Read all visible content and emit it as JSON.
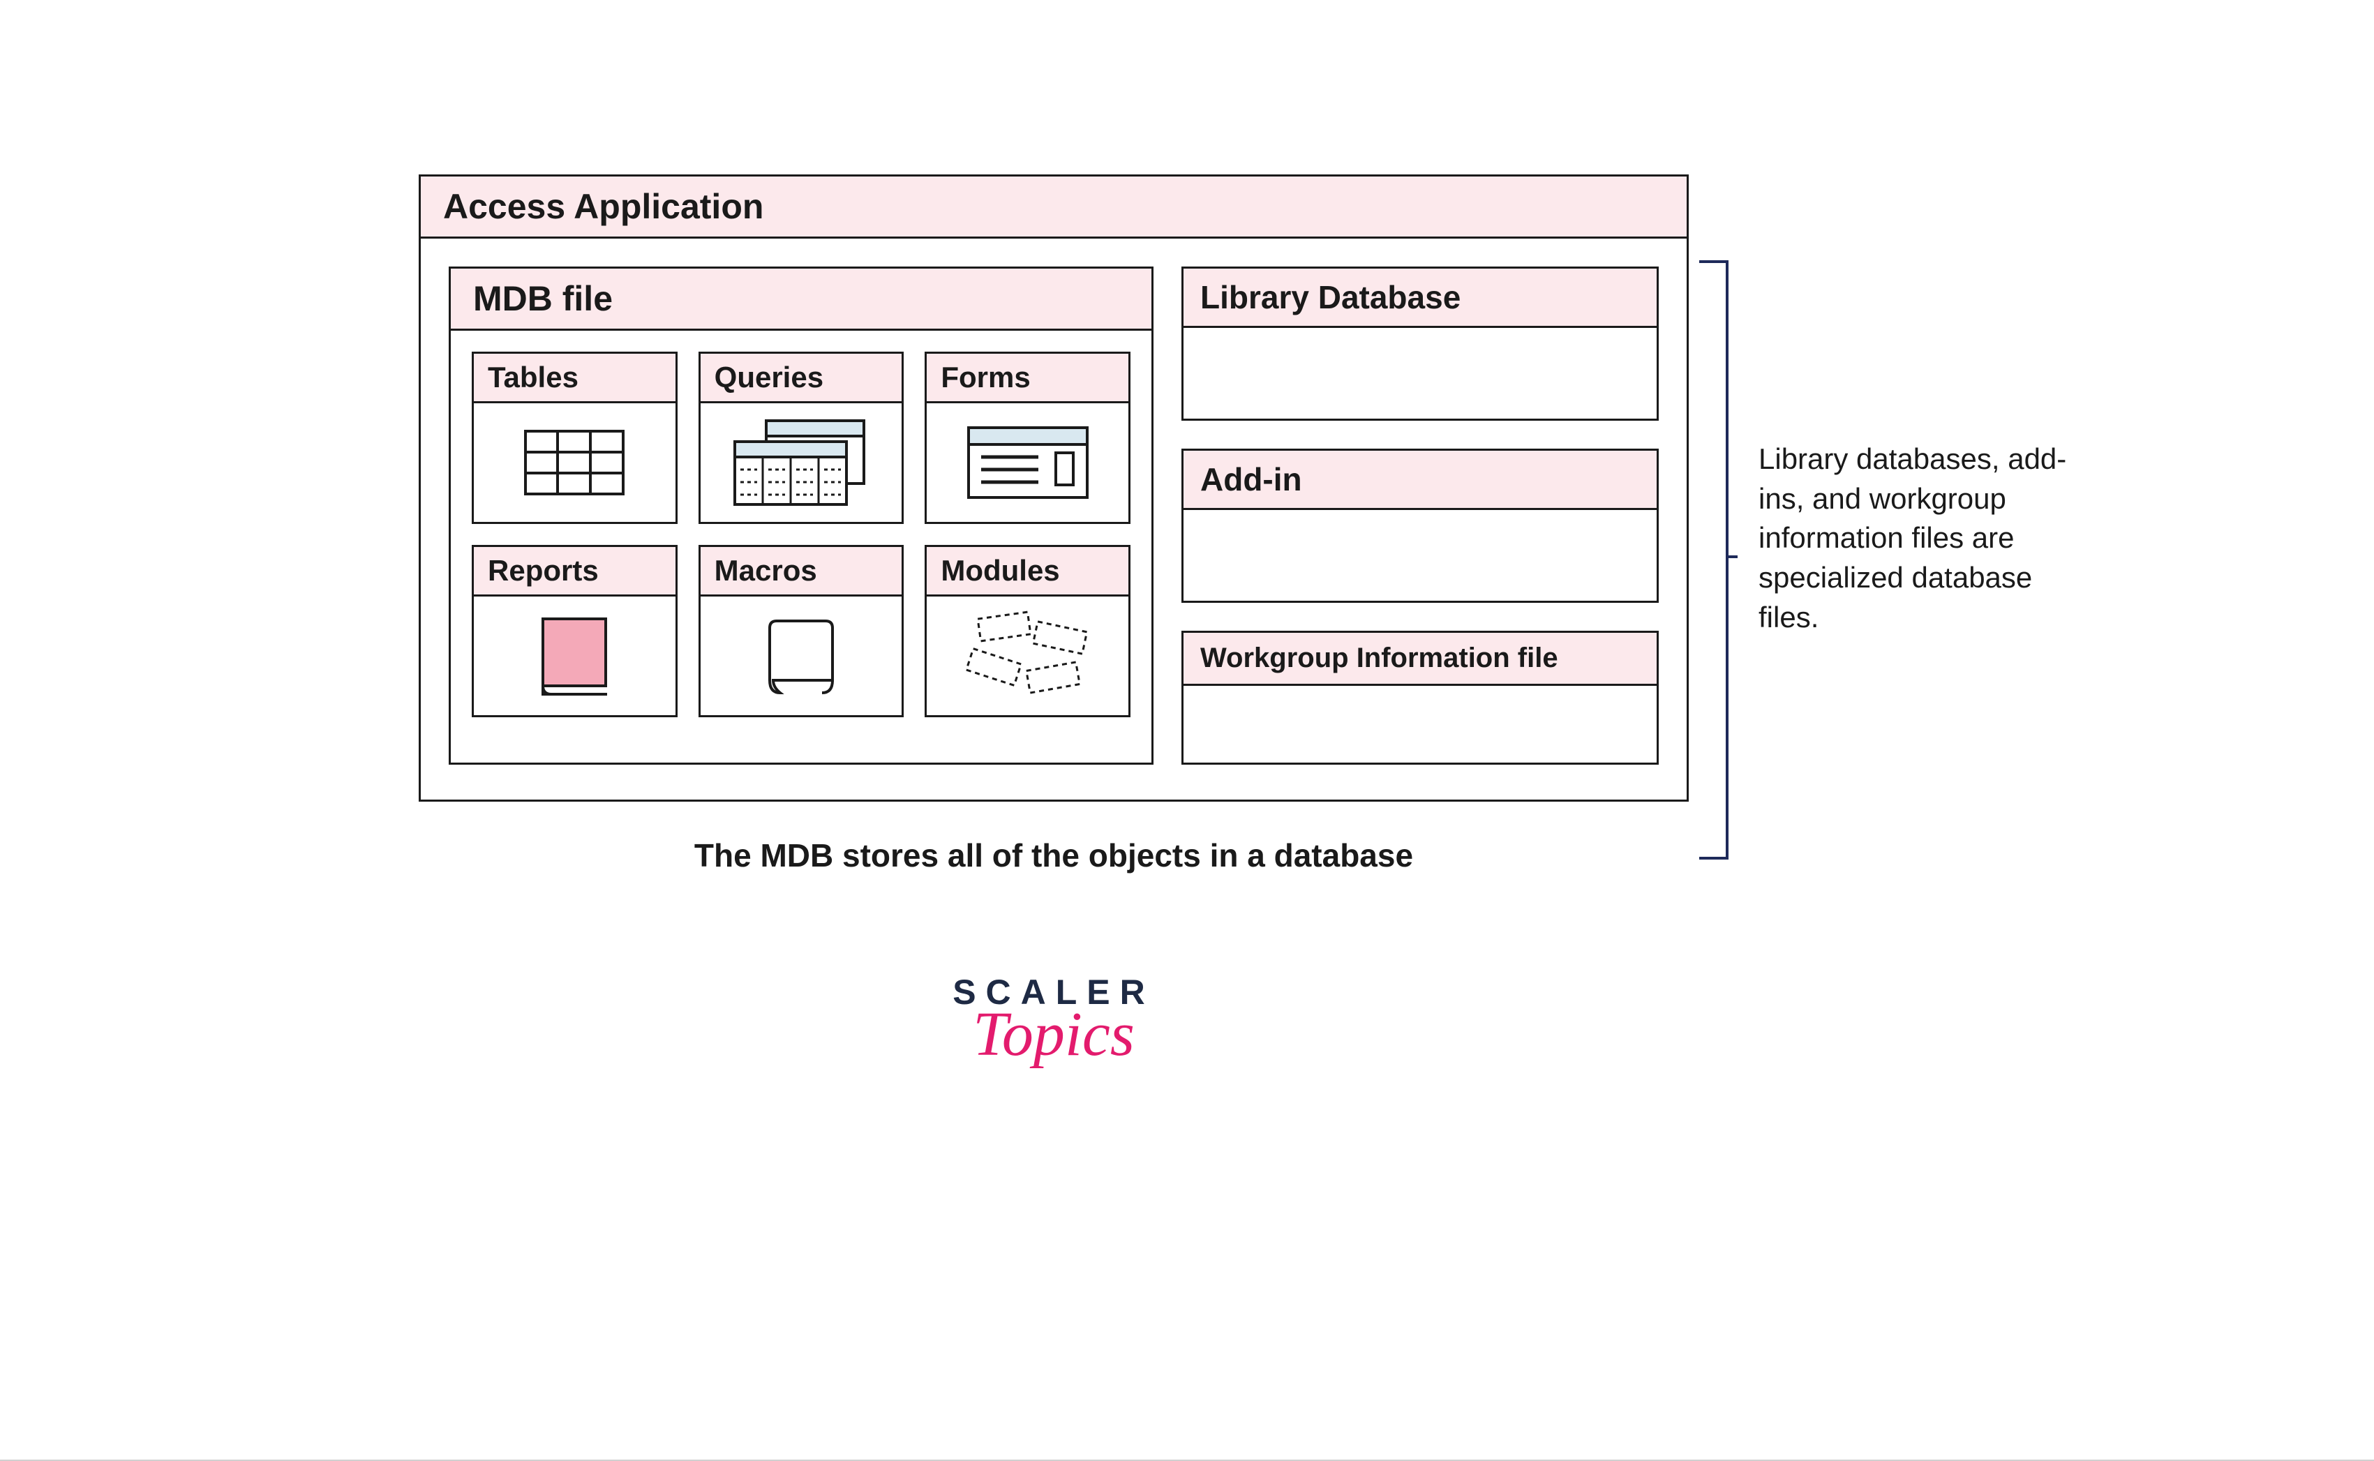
{
  "app": {
    "title": "Access Application"
  },
  "mdb": {
    "title": "MDB file",
    "objects": [
      {
        "label": "Tables",
        "icon": "tables-icon"
      },
      {
        "label": "Queries",
        "icon": "queries-icon"
      },
      {
        "label": "Forms",
        "icon": "forms-icon"
      },
      {
        "label": "Reports",
        "icon": "reports-icon"
      },
      {
        "label": "Macros",
        "icon": "macros-icon"
      },
      {
        "label": "Modules",
        "icon": "modules-icon"
      }
    ]
  },
  "side": [
    {
      "label": "Library Database"
    },
    {
      "label": "Add-in"
    },
    {
      "label": "Workgroup Information file"
    }
  ],
  "annotation": "Library databases, add-ins, and workgroup information files are specialized database files.",
  "caption": "The MDB stores all of the objects in a database",
  "logo": {
    "line1": "SCALER",
    "line2": "Topics"
  },
  "colors": {
    "header_bg": "#fce9ec",
    "icon_accent_blue": "#d9e8f0",
    "icon_accent_pink": "#f4a9b8",
    "bracket": "#1e2a5a",
    "logo_dark": "#1e2a44",
    "logo_pink": "#e31b6d"
  }
}
